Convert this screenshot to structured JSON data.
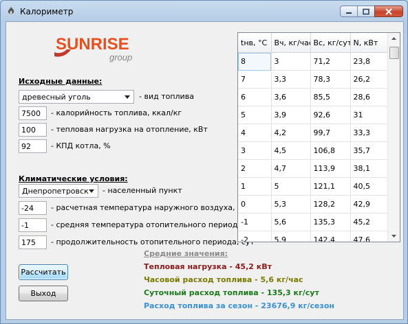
{
  "window": {
    "title": "Калориметр",
    "icon": "flame-app-icon"
  },
  "logo": {
    "brand": "SUNRISE",
    "sub": "group"
  },
  "initial": {
    "title": "Исходные данные:",
    "fuel_type": {
      "value": "древесный уголь",
      "label": "- вид топлива"
    },
    "calorific": {
      "value": "7500",
      "label": "- калорийность топлива, ккал/кг"
    },
    "heat_load": {
      "value": "100",
      "label": "- тепловая нагрузка на отопление, кВт"
    },
    "efficiency": {
      "value": "92",
      "label": "- КПД котла, %"
    }
  },
  "climate": {
    "title": "Климатические условия:",
    "city": {
      "value": "Днепропетровск",
      "label": "- населенный пункт"
    },
    "design_temp": {
      "value": "-24",
      "label": "- расчетная температура наружного воздуха, °С"
    },
    "avg_temp": {
      "value": "-1",
      "label": "- средняя температура отопительного периода, °С"
    },
    "duration": {
      "value": "175",
      "label": "- продолжительность отопительного периода, сут"
    }
  },
  "buttons": {
    "calculate": "Рассчитать",
    "exit": "Выход"
  },
  "table": {
    "columns": [
      "tнв, °C",
      "Вч, кг/час",
      "Вс, кг/сут",
      "N, кВт"
    ],
    "rows": [
      [
        "8",
        "3",
        "71,2",
        "23,8"
      ],
      [
        "7",
        "3,3",
        "78,3",
        "26,2"
      ],
      [
        "6",
        "3,6",
        "85,5",
        "28,6"
      ],
      [
        "5",
        "3,9",
        "92,6",
        "31"
      ],
      [
        "4",
        "4,2",
        "99,7",
        "33,3"
      ],
      [
        "3",
        "4,5",
        "106,8",
        "35,7"
      ],
      [
        "2",
        "4,7",
        "113,9",
        "38,1"
      ],
      [
        "1",
        "5",
        "121,1",
        "40,5"
      ],
      [
        "0",
        "5,3",
        "128,2",
        "42,9"
      ],
      [
        "-1",
        "5,6",
        "135,3",
        "45,2"
      ],
      [
        "-2",
        "5,9",
        "142,4",
        "47,6"
      ]
    ]
  },
  "averages": {
    "title": "Средние значения:",
    "heat_load": {
      "text": "Тепловая нагрузка - 45,2 кВт",
      "color": "#8b1a1a"
    },
    "hourly": {
      "text": "Часовой расход топлива - 5,6 кг/час",
      "color": "#7a7a00"
    },
    "daily": {
      "text": "Суточный расход топлива - 135,3 кг/сут",
      "color": "#1a7a1a"
    },
    "season": {
      "text": "Расход топлива за сезон - 23676,9 кг/сезон",
      "color": "#3a8fd6"
    }
  }
}
